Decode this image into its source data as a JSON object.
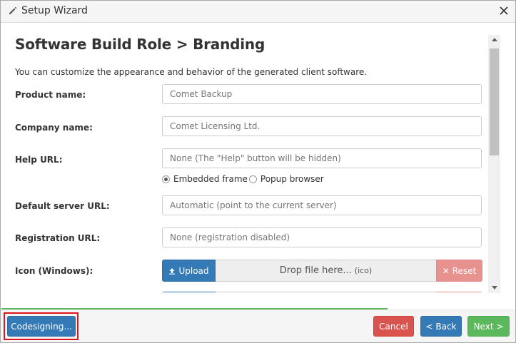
{
  "window": {
    "title": "Setup Wizard",
    "icon": "pencil-icon",
    "close_icon": "close-icon"
  },
  "page": {
    "heading": "Software Build Role > Branding",
    "description": "You can customize the appearance and behavior of the generated client software."
  },
  "form": {
    "product_name": {
      "label": "Product name:",
      "placeholder": "Comet Backup",
      "value": ""
    },
    "company_name": {
      "label": "Company name:",
      "placeholder": "Comet Licensing Ltd.",
      "value": ""
    },
    "help_url": {
      "label": "Help URL:",
      "placeholder": "None (The \"Help\" button will be hidden)",
      "value": "",
      "mode_options": [
        "Embedded frame",
        "Popup browser"
      ],
      "selected_mode": "Embedded frame"
    },
    "default_server_url": {
      "label": "Default server URL:",
      "placeholder": "Automatic (point to the current server)",
      "value": ""
    },
    "registration_url": {
      "label": "Registration URL:",
      "placeholder": "None (registration disabled)",
      "value": ""
    },
    "icon_windows": {
      "label": "Icon (Windows):",
      "upload_label": "Upload",
      "upload_icon": "upload-icon",
      "drop_text": "Drop file here...",
      "drop_hint": "(ico)",
      "reset_label": "Reset",
      "reset_icon": "times-icon"
    }
  },
  "footer": {
    "codesigning_label": "Codesigning...",
    "cancel_label": "Cancel",
    "back_label": "< Back",
    "next_label": "Next >",
    "progress_fraction": 0.75
  },
  "colors": {
    "primary": "#337ab7",
    "danger": "#d9534f",
    "success": "#5cb85c",
    "reset": "#e8928f",
    "highlight": "#d9161c"
  }
}
